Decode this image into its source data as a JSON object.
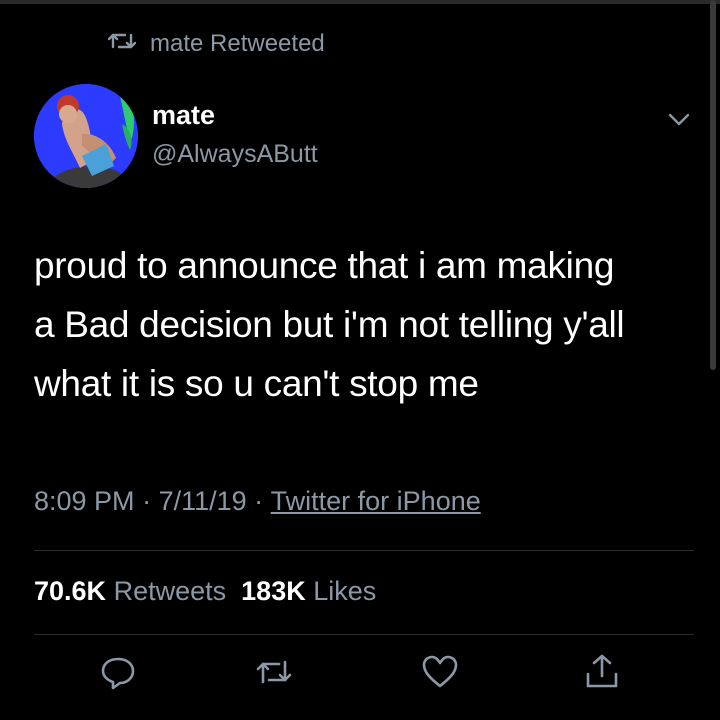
{
  "retweet_banner": {
    "icon": "retweet-icon",
    "text": "mate Retweeted"
  },
  "author": {
    "name": "mate",
    "handle": "@AlwaysAButt",
    "avatar": "avatar"
  },
  "tweet": {
    "lines": [
      "proud to announce that i am making",
      "a Bad decision but i'm not telling y'all",
      "what it is so u can't stop me"
    ]
  },
  "meta": {
    "time": "8:09 PM",
    "date": "7/11/19",
    "source": "Twitter for iPhone"
  },
  "stats": {
    "retweets_count": "70.6K",
    "retweets_label": "Retweets",
    "likes_count": "183K",
    "likes_label": "Likes"
  },
  "actions": [
    "reply-icon",
    "retweet-icon",
    "like-icon",
    "share-icon"
  ],
  "colors": {
    "background": "#000000",
    "text": "#ffffff",
    "secondary": "#8b98a5",
    "avatar_bg": "#2d3bff"
  }
}
